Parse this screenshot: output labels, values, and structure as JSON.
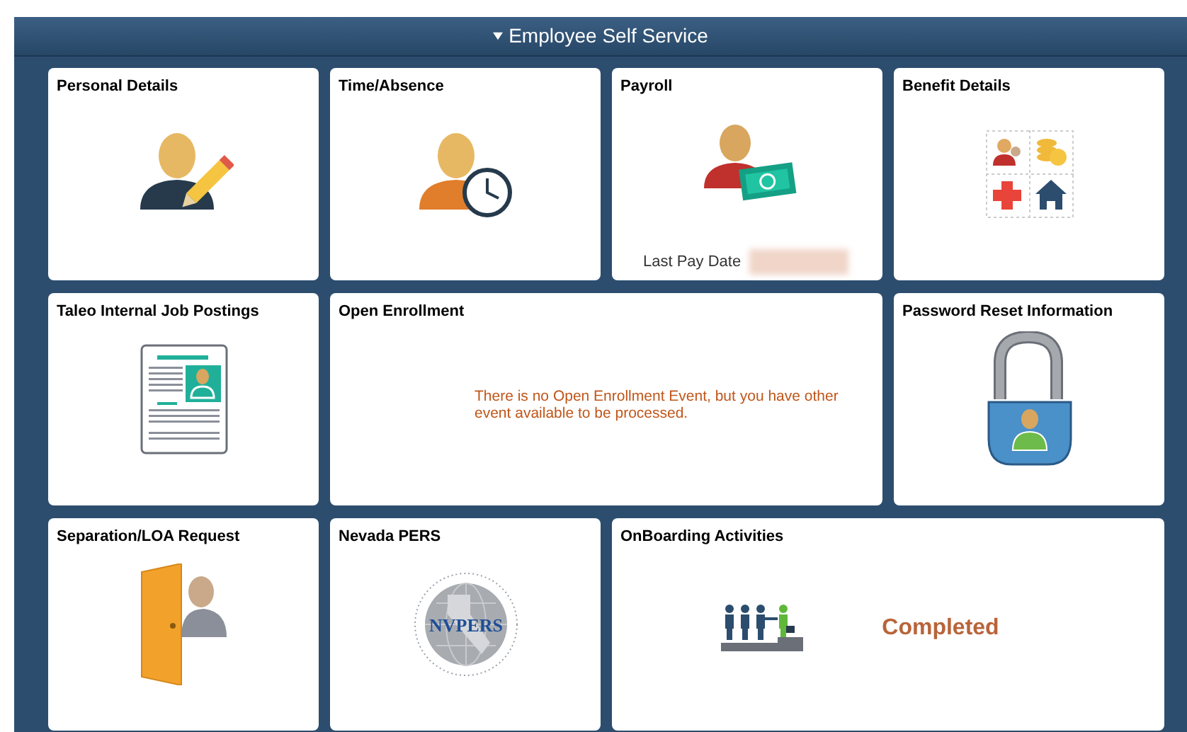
{
  "header": {
    "title": "Employee Self Service",
    "expanded": true
  },
  "tiles": [
    {
      "title": "Personal Details"
    },
    {
      "title": "Time/Absence"
    },
    {
      "title": "Payroll",
      "footer_label": "Last Pay Date",
      "footer_value_redacted": true
    },
    {
      "title": "Benefit Details"
    },
    {
      "title": "Taleo Internal Job Postings"
    },
    {
      "title": "Open Enrollment",
      "message": "There is no Open Enrollment Event, but you have other event available to be processed."
    },
    {
      "title": "Password Reset Information"
    },
    {
      "title": "Separation/LOA Request"
    },
    {
      "title": "Nevada PERS",
      "logo_text": "NVPERS"
    },
    {
      "title": "OnBoarding Activities",
      "status": "Completed"
    }
  ]
}
